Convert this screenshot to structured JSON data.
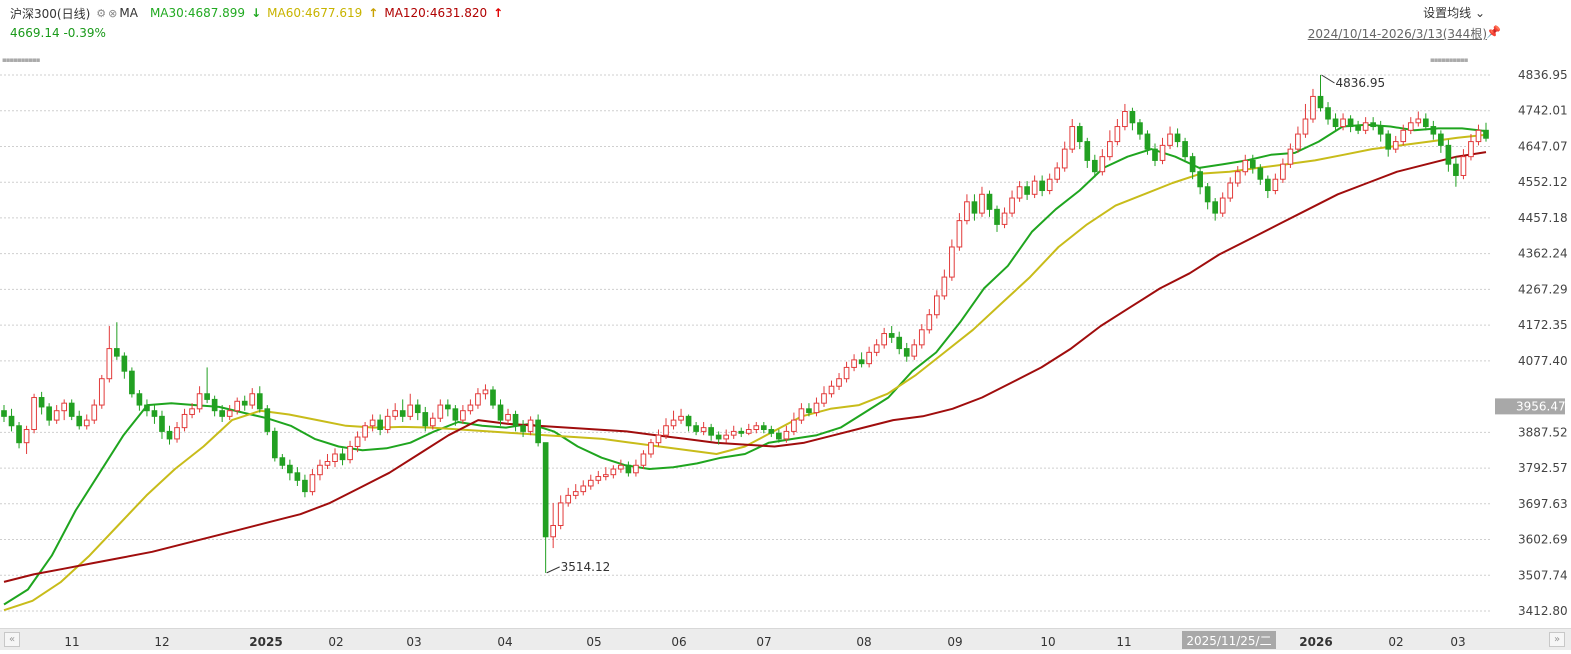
{
  "header": {
    "index_name": "沪深300(日线)",
    "gear_icon": "gear-icon",
    "close_icon": "close-icon",
    "indicator": "MA",
    "ma30_text": "MA30:4687.899",
    "ma30_trend": "↓",
    "ma60_text": "MA60:4677.619",
    "ma60_trend": "↑",
    "ma120_text": "MA120:4631.820",
    "ma120_trend": "↑",
    "quote": "4669.14 -0.39%",
    "settings_label": "设置均线",
    "settings_icon": "chevron-down-icon",
    "range": "2024/10/14-2026/3/13(344根)",
    "pin_icon": "pin-icon"
  },
  "colors": {
    "up": "#e23b3b",
    "down": "#22a022",
    "ma30": "#1fa51f",
    "ma60": "#c8bc1a",
    "ma120": "#a00d0d",
    "grid": "#cfcfcf"
  },
  "chart_data": {
    "type": "candlestick",
    "x_axis": {
      "ticks": [
        "11",
        "12",
        "2025",
        "02",
        "03",
        "04",
        "05",
        "06",
        "07",
        "08",
        "09",
        "10",
        "11",
        "12",
        "2026",
        "02",
        "03"
      ],
      "crosshair_date": "2025/11/25/二"
    },
    "y_axis": {
      "ticks": [
        "4836.95",
        "4742.01",
        "4647.07",
        "4552.12",
        "4457.18",
        "4362.24",
        "4267.29",
        "4172.35",
        "4077.40",
        "3956.47",
        "3887.52",
        "3792.57",
        "3697.63",
        "3602.69",
        "3507.74",
        "3412.80"
      ],
      "crosshair_value": "3956.47",
      "range": [
        3412.8,
        4836.95
      ]
    },
    "annotations": {
      "max_label": "4836.95",
      "min_label": "3514.12"
    },
    "series": [
      {
        "name": "MA30",
        "values": [
          3430,
          3470,
          3560,
          3680,
          3780,
          3880,
          3960,
          3965,
          3960,
          3955,
          3940,
          3925,
          3905,
          3870,
          3850,
          3840,
          3845,
          3860,
          3890,
          3915,
          3905,
          3900,
          3910,
          3890,
          3850,
          3820,
          3800,
          3790,
          3795,
          3805,
          3820,
          3830,
          3860,
          3870,
          3880,
          3900,
          3940,
          3980,
          4050,
          4100,
          4180,
          4270,
          4330,
          4420,
          4480,
          4530,
          4590,
          4620,
          4640,
          4620,
          4590,
          4600,
          4610,
          4625,
          4630,
          4660,
          4700,
          4705,
          4700,
          4690,
          4695,
          4695,
          4688
        ]
      },
      {
        "name": "MA60",
        "values": [
          3415,
          3440,
          3490,
          3560,
          3640,
          3720,
          3790,
          3850,
          3920,
          3945,
          3935,
          3920,
          3905,
          3900,
          3902,
          3900,
          3895,
          3890,
          3885,
          3880,
          3875,
          3870,
          3860,
          3850,
          3840,
          3830,
          3850,
          3890,
          3930,
          3950,
          3960,
          3990,
          4040,
          4100,
          4160,
          4230,
          4300,
          4380,
          4440,
          4490,
          4520,
          4550,
          4575,
          4580,
          4590,
          4600,
          4610,
          4625,
          4640,
          4650,
          4660,
          4670,
          4678
        ]
      },
      {
        "name": "MA120",
        "values": [
          3490,
          3510,
          3525,
          3540,
          3555,
          3570,
          3590,
          3610,
          3630,
          3650,
          3670,
          3700,
          3740,
          3780,
          3830,
          3880,
          3920,
          3910,
          3905,
          3900,
          3895,
          3890,
          3880,
          3870,
          3860,
          3855,
          3850,
          3860,
          3880,
          3900,
          3920,
          3930,
          3950,
          3980,
          4020,
          4060,
          4110,
          4170,
          4220,
          4270,
          4310,
          4360,
          4400,
          4440,
          4480,
          4520,
          4550,
          4580,
          4600,
          4620,
          4632
        ]
      }
    ],
    "candles": [
      [
        3945,
        3930,
        3960,
        3915
      ],
      [
        3930,
        3905,
        3950,
        3890
      ],
      [
        3905,
        3860,
        3915,
        3845
      ],
      [
        3860,
        3895,
        3905,
        3830
      ],
      [
        3895,
        3980,
        3990,
        3885
      ],
      [
        3980,
        3955,
        3995,
        3935
      ],
      [
        3955,
        3920,
        3965,
        3905
      ],
      [
        3920,
        3945,
        3960,
        3910
      ],
      [
        3945,
        3965,
        3975,
        3920
      ],
      [
        3965,
        3930,
        3975,
        3920
      ],
      [
        3930,
        3905,
        3945,
        3895
      ],
      [
        3905,
        3920,
        3935,
        3895
      ],
      [
        3920,
        3960,
        3975,
        3910
      ],
      [
        3960,
        4030,
        4040,
        3950
      ],
      [
        4030,
        4110,
        4170,
        4020
      ],
      [
        4110,
        4090,
        4180,
        4080
      ],
      [
        4090,
        4050,
        4100,
        4030
      ],
      [
        4050,
        3990,
        4060,
        3980
      ],
      [
        3990,
        3960,
        4000,
        3945
      ],
      [
        3960,
        3945,
        3975,
        3930
      ],
      [
        3945,
        3930,
        3960,
        3910
      ],
      [
        3930,
        3890,
        3945,
        3870
      ],
      [
        3890,
        3870,
        3905,
        3855
      ],
      [
        3870,
        3900,
        3915,
        3860
      ],
      [
        3900,
        3935,
        3950,
        3890
      ],
      [
        3935,
        3950,
        3965,
        3925
      ],
      [
        3950,
        3990,
        4010,
        3940
      ],
      [
        3990,
        3975,
        4060,
        3965
      ],
      [
        3975,
        3945,
        3985,
        3930
      ],
      [
        3945,
        3930,
        3960,
        3915
      ],
      [
        3930,
        3945,
        3960,
        3920
      ],
      [
        3945,
        3970,
        3980,
        3935
      ],
      [
        3970,
        3960,
        3985,
        3945
      ],
      [
        3960,
        3990,
        4005,
        3950
      ],
      [
        3990,
        3950,
        4010,
        3940
      ],
      [
        3950,
        3890,
        3960,
        3880
      ],
      [
        3890,
        3820,
        3900,
        3810
      ],
      [
        3820,
        3800,
        3830,
        3790
      ],
      [
        3800,
        3780,
        3815,
        3760
      ],
      [
        3780,
        3760,
        3795,
        3745
      ],
      [
        3760,
        3730,
        3775,
        3715
      ],
      [
        3730,
        3775,
        3790,
        3720
      ],
      [
        3775,
        3800,
        3815,
        3760
      ],
      [
        3800,
        3810,
        3830,
        3790
      ],
      [
        3810,
        3830,
        3845,
        3795
      ],
      [
        3830,
        3815,
        3845,
        3800
      ],
      [
        3815,
        3850,
        3865,
        3805
      ],
      [
        3850,
        3875,
        3890,
        3835
      ],
      [
        3875,
        3905,
        3915,
        3865
      ],
      [
        3905,
        3920,
        3935,
        3890
      ],
      [
        3920,
        3895,
        3935,
        3880
      ],
      [
        3895,
        3930,
        3950,
        3885
      ],
      [
        3930,
        3945,
        3965,
        3920
      ],
      [
        3945,
        3930,
        3975,
        3915
      ],
      [
        3930,
        3960,
        3990,
        3920
      ],
      [
        3960,
        3940,
        3975,
        3920
      ],
      [
        3940,
        3905,
        3955,
        3890
      ],
      [
        3905,
        3925,
        3940,
        3895
      ],
      [
        3925,
        3960,
        3975,
        3915
      ],
      [
        3960,
        3950,
        3975,
        3930
      ],
      [
        3950,
        3920,
        3960,
        3905
      ],
      [
        3920,
        3945,
        3960,
        3910
      ],
      [
        3945,
        3960,
        3975,
        3935
      ],
      [
        3960,
        3990,
        4005,
        3950
      ],
      [
        3990,
        4000,
        4015,
        3975
      ],
      [
        4000,
        3960,
        4010,
        3950
      ],
      [
        3960,
        3920,
        3975,
        3905
      ],
      [
        3920,
        3935,
        3950,
        3910
      ],
      [
        3935,
        3905,
        3945,
        3890
      ],
      [
        3905,
        3890,
        3920,
        3875
      ],
      [
        3890,
        3920,
        3930,
        3880
      ],
      [
        3920,
        3860,
        3935,
        3850
      ],
      [
        3860,
        3610,
        3860,
        3514
      ],
      [
        3610,
        3640,
        3700,
        3580
      ],
      [
        3640,
        3700,
        3720,
        3630
      ],
      [
        3700,
        3720,
        3740,
        3690
      ],
      [
        3720,
        3730,
        3750,
        3710
      ],
      [
        3730,
        3745,
        3760,
        3720
      ],
      [
        3745,
        3760,
        3775,
        3735
      ],
      [
        3760,
        3770,
        3785,
        3750
      ],
      [
        3770,
        3775,
        3795,
        3760
      ],
      [
        3775,
        3790,
        3800,
        3765
      ],
      [
        3790,
        3800,
        3815,
        3780
      ],
      [
        3800,
        3780,
        3810,
        3770
      ],
      [
        3780,
        3800,
        3815,
        3770
      ],
      [
        3800,
        3830,
        3840,
        3790
      ],
      [
        3830,
        3860,
        3870,
        3820
      ],
      [
        3860,
        3880,
        3895,
        3850
      ],
      [
        3880,
        3905,
        3925,
        3870
      ],
      [
        3905,
        3920,
        3945,
        3895
      ],
      [
        3920,
        3930,
        3950,
        3910
      ],
      [
        3930,
        3905,
        3935,
        3890
      ],
      [
        3905,
        3890,
        3915,
        3880
      ],
      [
        3890,
        3900,
        3915,
        3880
      ],
      [
        3900,
        3880,
        3910,
        3865
      ],
      [
        3880,
        3870,
        3890,
        3855
      ],
      [
        3870,
        3880,
        3895,
        3860
      ],
      [
        3880,
        3890,
        3905,
        3870
      ],
      [
        3890,
        3885,
        3900,
        3875
      ],
      [
        3885,
        3895,
        3910,
        3880
      ],
      [
        3895,
        3905,
        3915,
        3885
      ],
      [
        3905,
        3895,
        3915,
        3885
      ],
      [
        3895,
        3885,
        3905,
        3875
      ],
      [
        3885,
        3870,
        3895,
        3860
      ],
      [
        3870,
        3890,
        3905,
        3860
      ],
      [
        3890,
        3920,
        3940,
        3880
      ],
      [
        3920,
        3950,
        3965,
        3910
      ],
      [
        3950,
        3940,
        3965,
        3930
      ],
      [
        3940,
        3965,
        3980,
        3930
      ],
      [
        3965,
        3990,
        4010,
        3955
      ],
      [
        3990,
        4010,
        4025,
        3980
      ],
      [
        4010,
        4030,
        4045,
        4000
      ],
      [
        4030,
        4060,
        4075,
        4020
      ],
      [
        4060,
        4080,
        4095,
        4050
      ],
      [
        4080,
        4070,
        4100,
        4060
      ],
      [
        4070,
        4100,
        4115,
        4060
      ],
      [
        4100,
        4120,
        4135,
        4090
      ],
      [
        4120,
        4150,
        4165,
        4110
      ],
      [
        4150,
        4140,
        4170,
        4125
      ],
      [
        4140,
        4110,
        4155,
        4095
      ],
      [
        4110,
        4090,
        4125,
        4075
      ],
      [
        4090,
        4120,
        4135,
        4080
      ],
      [
        4120,
        4160,
        4175,
        4110
      ],
      [
        4160,
        4200,
        4215,
        4150
      ],
      [
        4200,
        4250,
        4265,
        4190
      ],
      [
        4250,
        4300,
        4320,
        4240
      ],
      [
        4300,
        4380,
        4400,
        4290
      ],
      [
        4380,
        4450,
        4470,
        4370
      ],
      [
        4450,
        4500,
        4520,
        4440
      ],
      [
        4500,
        4470,
        4520,
        4450
      ],
      [
        4470,
        4520,
        4540,
        4460
      ],
      [
        4520,
        4480,
        4530,
        4460
      ],
      [
        4480,
        4440,
        4490,
        4420
      ],
      [
        4440,
        4470,
        4485,
        4430
      ],
      [
        4470,
        4510,
        4530,
        4460
      ],
      [
        4510,
        4540,
        4555,
        4500
      ],
      [
        4540,
        4520,
        4555,
        4505
      ],
      [
        4520,
        4555,
        4570,
        4510
      ],
      [
        4555,
        4530,
        4570,
        4515
      ],
      [
        4530,
        4560,
        4575,
        4520
      ],
      [
        4560,
        4590,
        4605,
        4550
      ],
      [
        4590,
        4640,
        4660,
        4580
      ],
      [
        4640,
        4700,
        4720,
        4630
      ],
      [
        4700,
        4660,
        4710,
        4640
      ],
      [
        4660,
        4610,
        4670,
        4590
      ],
      [
        4610,
        4580,
        4625,
        4565
      ],
      [
        4580,
        4620,
        4640,
        4570
      ],
      [
        4620,
        4660,
        4690,
        4610
      ],
      [
        4660,
        4700,
        4720,
        4650
      ],
      [
        4700,
        4740,
        4760,
        4690
      ],
      [
        4740,
        4710,
        4750,
        4690
      ],
      [
        4710,
        4680,
        4720,
        4665
      ],
      [
        4680,
        4640,
        4690,
        4625
      ],
      [
        4640,
        4610,
        4655,
        4595
      ],
      [
        4610,
        4650,
        4670,
        4600
      ],
      [
        4650,
        4680,
        4700,
        4640
      ],
      [
        4680,
        4660,
        4695,
        4645
      ],
      [
        4660,
        4620,
        4670,
        4605
      ],
      [
        4620,
        4580,
        4630,
        4560
      ],
      [
        4580,
        4540,
        4590,
        4520
      ],
      [
        4540,
        4500,
        4550,
        4480
      ],
      [
        4500,
        4470,
        4510,
        4450
      ],
      [
        4470,
        4510,
        4525,
        4460
      ],
      [
        4510,
        4550,
        4565,
        4500
      ],
      [
        4550,
        4580,
        4595,
        4540
      ],
      [
        4580,
        4610,
        4625,
        4570
      ],
      [
        4610,
        4590,
        4625,
        4575
      ],
      [
        4590,
        4560,
        4600,
        4545
      ],
      [
        4560,
        4530,
        4570,
        4510
      ],
      [
        4530,
        4560,
        4575,
        4520
      ],
      [
        4560,
        4600,
        4615,
        4550
      ],
      [
        4600,
        4640,
        4655,
        4590
      ],
      [
        4640,
        4680,
        4700,
        4630
      ],
      [
        4680,
        4720,
        4760,
        4670
      ],
      [
        4720,
        4780,
        4800,
        4710
      ],
      [
        4780,
        4750,
        4837,
        4740
      ],
      [
        4750,
        4720,
        4765,
        4705
      ],
      [
        4720,
        4700,
        4735,
        4690
      ],
      [
        4700,
        4720,
        4735,
        4690
      ],
      [
        4720,
        4700,
        4730,
        4685
      ],
      [
        4700,
        4690,
        4715,
        4680
      ],
      [
        4690,
        4710,
        4725,
        4680
      ],
      [
        4710,
        4700,
        4725,
        4690
      ],
      [
        4700,
        4680,
        4715,
        4660
      ],
      [
        4680,
        4640,
        4690,
        4620
      ],
      [
        4640,
        4660,
        4675,
        4630
      ],
      [
        4660,
        4690,
        4705,
        4650
      ],
      [
        4690,
        4710,
        4725,
        4680
      ],
      [
        4710,
        4720,
        4740,
        4700
      ],
      [
        4720,
        4700,
        4735,
        4690
      ],
      [
        4700,
        4680,
        4715,
        4665
      ],
      [
        4680,
        4650,
        4690,
        4630
      ],
      [
        4650,
        4600,
        4665,
        4580
      ],
      [
        4600,
        4570,
        4620,
        4540
      ],
      [
        4570,
        4620,
        4640,
        4560
      ],
      [
        4620,
        4660,
        4680,
        4610
      ],
      [
        4660,
        4690,
        4705,
        4650
      ],
      [
        4690,
        4669,
        4710,
        4660
      ]
    ]
  }
}
